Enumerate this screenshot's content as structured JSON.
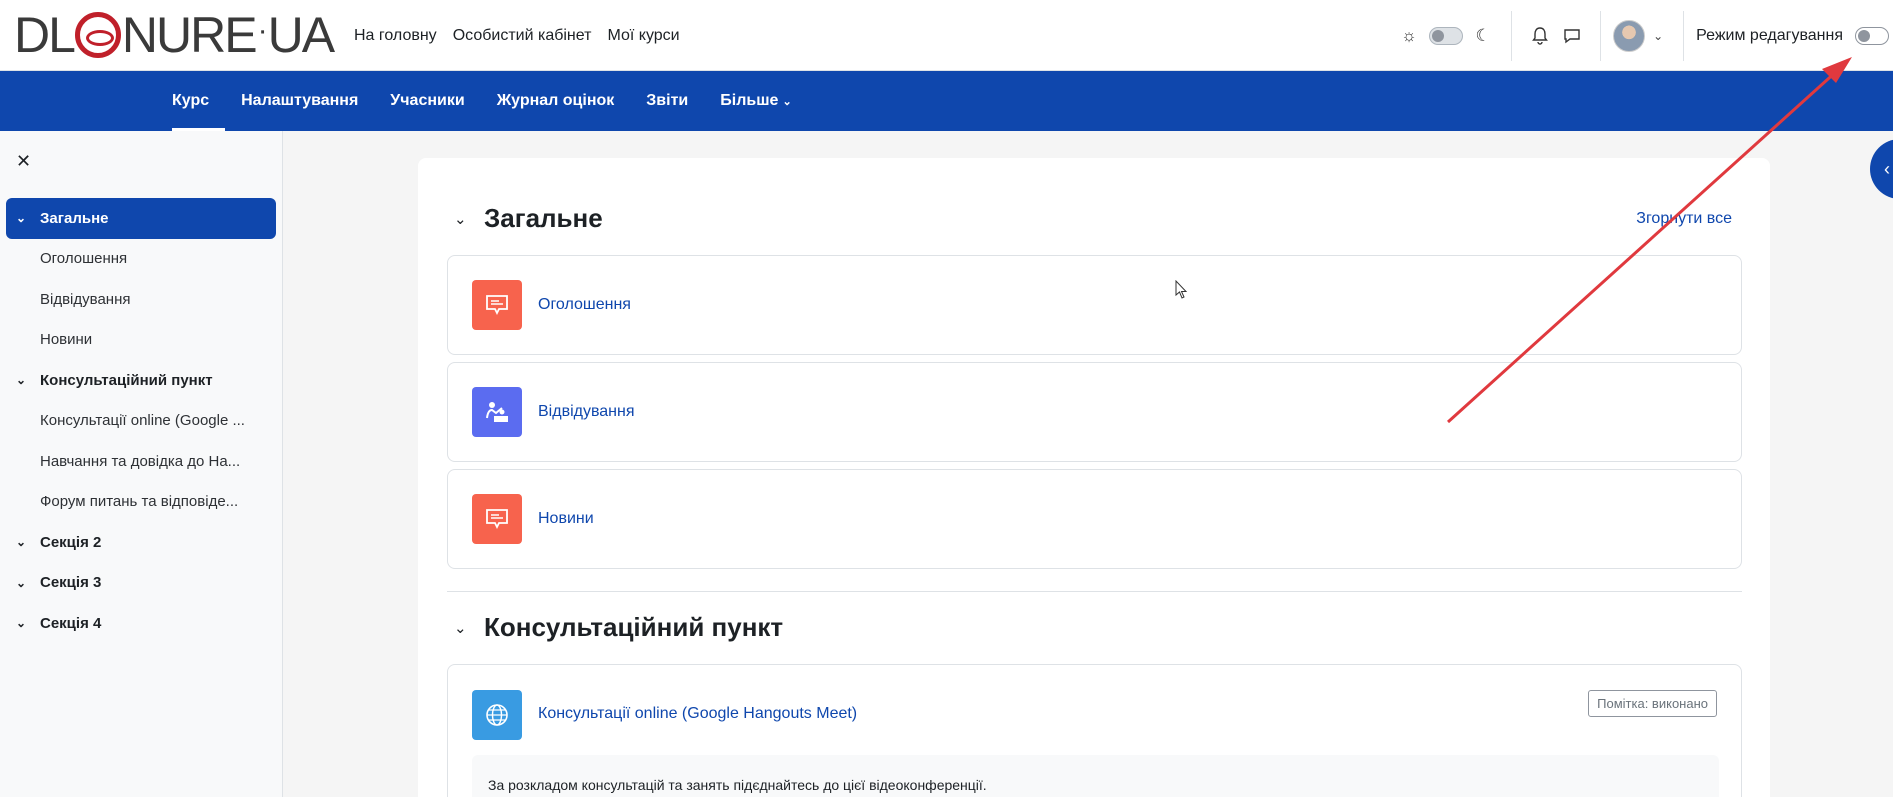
{
  "logo": {
    "left": "DL",
    "right": "NURE",
    "tld": "UA"
  },
  "topnav": {
    "home": "На головну",
    "dashboard": "Особистий кабінет",
    "mycourses": "Мої курси"
  },
  "topright": {
    "edit_mode_label": "Режим редагування"
  },
  "secnav": {
    "course": "Курс",
    "settings": "Налаштування",
    "participants": "Учасники",
    "grades": "Журнал оцінок",
    "reports": "Звіти",
    "more": "Більше"
  },
  "drawer": {
    "items": [
      {
        "label": "Загальне"
      },
      {
        "label": "Оголошення"
      },
      {
        "label": "Відвідування"
      },
      {
        "label": "Новини"
      },
      {
        "label": "Консультаційний пункт"
      },
      {
        "label": "Консультації online (Google ..."
      },
      {
        "label": "Навчання та довідка до На..."
      },
      {
        "label": "Форум питань та відповіде..."
      },
      {
        "label": "Секція 2"
      },
      {
        "label": "Секція 3"
      },
      {
        "label": "Секція 4"
      }
    ]
  },
  "main": {
    "collapse_all": "Згорнути все",
    "sections": [
      {
        "title": "Загальне",
        "activities": [
          {
            "name": "Оголошення"
          },
          {
            "name": "Відвідування"
          },
          {
            "name": "Новини"
          }
        ]
      },
      {
        "title": "Консультаційний пункт",
        "activities": [
          {
            "name": "Консультації online (Google Hangouts Meet)",
            "badge": "Помітка: виконано",
            "description": "За розкладом консультацій та занять підєднайтесь до цієї відеоконференції."
          }
        ]
      }
    ]
  },
  "colors": {
    "primary": "#0f47ad",
    "forum_icon": "#f7634d",
    "attendance_icon": "#5b6cf0",
    "url_icon": "#399be2",
    "annotation_arrow": "#e0393e"
  }
}
